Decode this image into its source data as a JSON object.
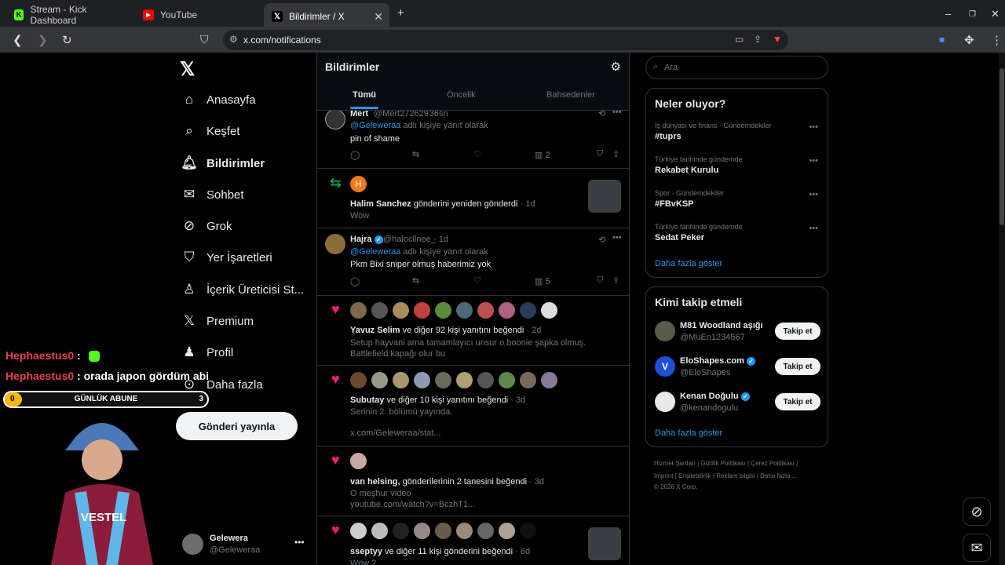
{
  "browser": {
    "tabs": [
      {
        "label": "Stream - Kick Dashboard"
      },
      {
        "label": "YouTube"
      },
      {
        "label": "Bildirimler / X"
      }
    ],
    "url": "x.com/notifications"
  },
  "nav": {
    "items": [
      {
        "label": "Anasayfa",
        "icon": "home-icon"
      },
      {
        "label": "Keşfet",
        "icon": "search-icon"
      },
      {
        "label": "Bildirimler",
        "icon": "bell-icon"
      },
      {
        "label": "Sohbet",
        "icon": "mail-icon"
      },
      {
        "label": "Grok",
        "icon": "grok-icon"
      },
      {
        "label": "Yer İşaretleri",
        "icon": "bookmark-icon"
      },
      {
        "label": "İçerik Üreticisi St...",
        "icon": "creator-icon"
      },
      {
        "label": "Premium",
        "icon": "x-icon"
      },
      {
        "label": "Profil",
        "icon": "person-icon"
      },
      {
        "label": "Daha fazla",
        "icon": "more-circle-icon"
      }
    ],
    "post_label": "Gönderi yayınla",
    "account_name": "Gelewera",
    "account_handle": "@Geleweraa"
  },
  "overlay": {
    "chat": [
      {
        "user": "Hephaestus0",
        "sep": " :",
        "msg": ""
      },
      {
        "user": "Hephaestus0",
        "sep": " :",
        "msg": " orada japon gördüm abi"
      }
    ],
    "sub_label": "GÜNLÜK ABUNE",
    "sub_current": "0",
    "sub_goal": "3",
    "sub_progress": 0.0
  },
  "main": {
    "title": "Bildirimler",
    "tabs": [
      "Tümü",
      "Öncelik",
      "Bahsedenler"
    ],
    "n1": {
      "name": "Mert",
      "handle": "@Mert272629",
      "time": "· 36sn",
      "reply_to": "@Geleweraa",
      "reply_suffix": " adlı kişiye yanıt olarak",
      "text": "pin of shame",
      "views": "2"
    },
    "n2": {
      "avatar_letter": "H",
      "name": "Halim Sanchez",
      "action": " gönderini yeniden gönderdi",
      "time": " · 1d",
      "text": "Wow"
    },
    "n3": {
      "name": "Hajra",
      "handle": "@halocllnee_",
      "time": "· 1d",
      "reply_to": "@Geleweraa",
      "reply_suffix": " adlı kişiye yanıt olarak",
      "text": "Pkm Bixi sniper olmuş haberimiz yok",
      "views": "5"
    },
    "n4": {
      "name": "Yavuz Selim",
      "action": " ve diğer 92 kişi yanıtını beğendi",
      "time": " · 2d",
      "text": "Setup hayvani ama tamamlayıcı unsur o boonie şapka olmuş. Battlefield kapağı olur bu"
    },
    "n5": {
      "name": "Subutay",
      "action": " ve diğer 10 kişi yanıtını beğendi",
      "time": " · 3d",
      "text": "Serinin 2. bölümü yayında.",
      "link": "x.com/Geleweraa/stat..."
    },
    "n6": {
      "name": "van helsing,",
      "action": " gönderilerinin 2 tanesini beğendi",
      "time": " · 3d",
      "text": "O meşhur video",
      "link": "youtube.com/watch?v=BczhT1..."
    },
    "n7": {
      "name": "sseptyy",
      "action": " ve diğer 11 kişi gönderini beğendi",
      "time": " · 6d",
      "text": "Wow 2"
    }
  },
  "right": {
    "search_placeholder": "Ara",
    "trends_title": "Neler oluyor?",
    "trends": [
      {
        "category": "İş dünyası ve finans · Gündemdekiler",
        "name": "#tupr͏s"
      },
      {
        "category": "Türkiye tarihinde gündemde",
        "name": "Rekabet Kurulu"
      },
      {
        "category": "Spor · Gündemdekiler",
        "name": "#FBvKSP"
      },
      {
        "category": "Türkiye tarihinde gündemde",
        "name": "Sedat Peker"
      }
    ],
    "show_more": "Daha fazla göster",
    "who_title": "Kimi takip etmeli",
    "who": [
      {
        "name": "M81 Woodland aşığı",
        "handle": "@MuEn1234567",
        "verified": false
      },
      {
        "name": "EloShapes.com",
        "handle": "@EloShapes",
        "verified": true
      },
      {
        "name": "Kenan Doğulu",
        "handle": "@kenandogulu",
        "verified": true
      }
    ],
    "follow_label": "Takip et",
    "footer1": "Hizmet Şartları  |  Gizlilik Politikası  |  Çerez Politikası  |",
    "footer2": "Imprint  |  Erişilebilirlik  |  Reklam bilgisi  |  Daha fazla ...",
    "footer3": "© 2026 X Corp."
  }
}
